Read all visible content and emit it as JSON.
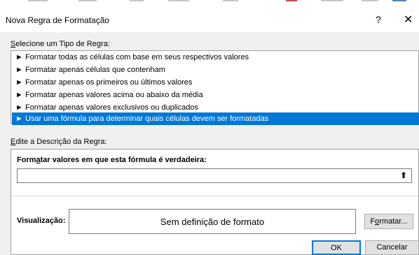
{
  "dialog": {
    "title": "Nova Regra de Formatação",
    "help_label": "?",
    "close_label": "✕"
  },
  "rule_type": {
    "heading_first": "S",
    "heading_rest": "elecione um Tipo de Regra:",
    "items": [
      {
        "label": "► Formatar todas as células com base em seus respectivos valores",
        "selected": false
      },
      {
        "label": "► Formatar apenas células que contenham",
        "selected": false
      },
      {
        "label": "► Formatar apenas os primeiros ou últimos valores",
        "selected": false
      },
      {
        "label": "► Formatar apenas valores acima ou abaixo da média",
        "selected": false
      },
      {
        "label": "► Formatar apenas valores exclusivos ou duplicados",
        "selected": false
      },
      {
        "label": "► Usar uma fórmula para determinar quais células devem ser formatadas",
        "selected": true
      }
    ]
  },
  "description": {
    "heading_first": "E",
    "heading_rest": "dite a Descrição da Regra:",
    "formula_label_pre": "Form",
    "formula_label_u": "a",
    "formula_label_post": "tar valores em que esta fórmula é verdadeira:",
    "formula_value": "",
    "collapse_icon": "⬆"
  },
  "preview": {
    "label": "Visualização:",
    "text": "Sem definição de formato",
    "format_button_pre": "F",
    "format_button_u": "o",
    "format_button_post": "rmatar..."
  },
  "buttons": {
    "ok": "OK",
    "cancel": "Cancelar"
  },
  "colors": {
    "selection": "#0078d7",
    "dialog_bg": "#f0f0f0"
  }
}
